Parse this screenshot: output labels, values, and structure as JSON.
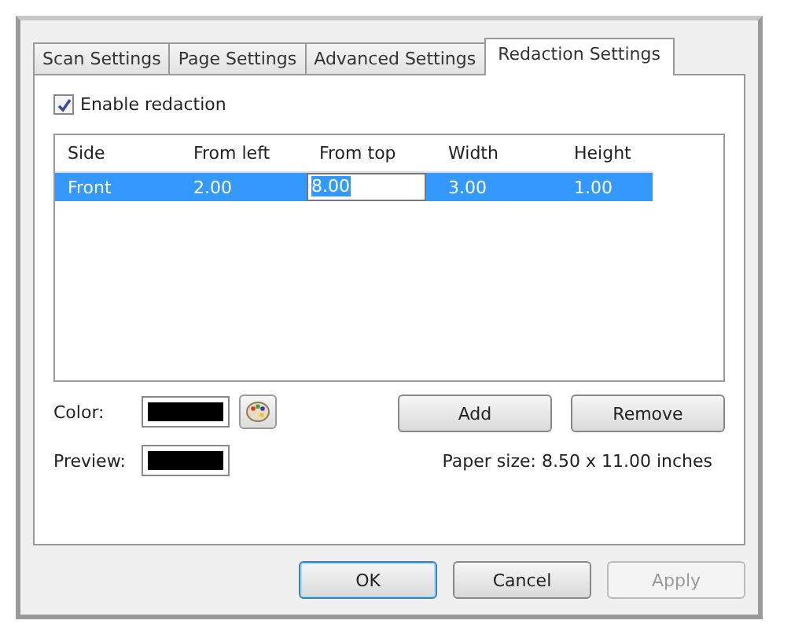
{
  "tabs": [
    {
      "label": "Scan Settings",
      "selected": false
    },
    {
      "label": "Page Settings",
      "selected": false
    },
    {
      "label": "Advanced Settings",
      "selected": false
    },
    {
      "label": "Redaction Settings",
      "selected": true
    }
  ],
  "enable": {
    "label": "Enable redaction",
    "checked": true
  },
  "table": {
    "columns": [
      "Side",
      "From left",
      "From top",
      "Width",
      "Height"
    ],
    "rows": [
      {
        "selected": true,
        "cells": [
          {
            "text": "Front",
            "editing": false
          },
          {
            "text": "2.00",
            "editing": false
          },
          {
            "text": "8.00",
            "editing": true
          },
          {
            "text": "3.00",
            "editing": false
          },
          {
            "text": "1.00",
            "editing": false
          }
        ]
      }
    ]
  },
  "color": {
    "label": "Color:",
    "color": "#000000"
  },
  "preview": {
    "label": "Preview:",
    "color": "#000000"
  },
  "add_button": "Add",
  "remove_button": "Remove",
  "paper_size": "Paper size:  8.50 x 11.00 inches",
  "buttons": [
    {
      "label": "OK",
      "kind": "default",
      "disabled": false
    },
    {
      "label": "Cancel",
      "kind": "normal",
      "disabled": false
    },
    {
      "label": "Apply",
      "kind": "normal",
      "disabled": true
    }
  ]
}
